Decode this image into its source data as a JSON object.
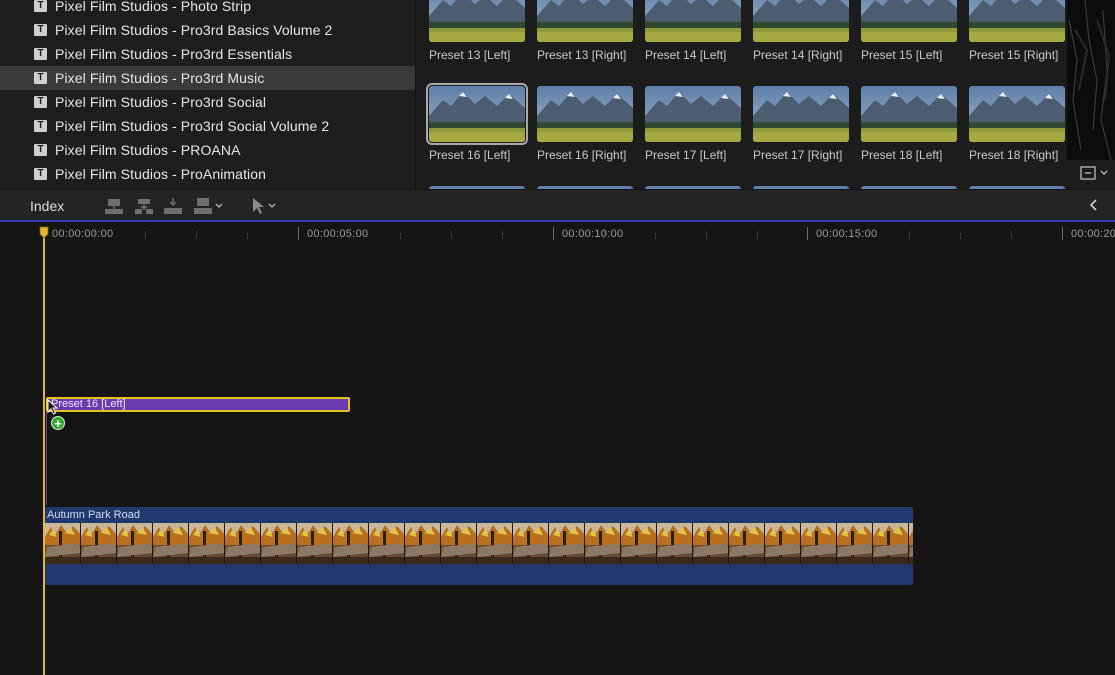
{
  "browser": {
    "libraries": [
      {
        "icon": "title-icon",
        "label": "Pixel Film Studios - Photo Strip",
        "selected": false
      },
      {
        "icon": "title-icon",
        "label": "Pixel Film Studios - Pro3rd Basics Volume 2",
        "selected": false
      },
      {
        "icon": "title-icon",
        "label": "Pixel Film Studios - Pro3rd Essentials",
        "selected": false
      },
      {
        "icon": "title-icon",
        "label": "Pixel Film Studios - Pro3rd Music",
        "selected": true
      },
      {
        "icon": "title-icon",
        "label": "Pixel Film Studios - Pro3rd Social",
        "selected": false
      },
      {
        "icon": "title-icon",
        "label": "Pixel Film Studios - Pro3rd Social Volume 2",
        "selected": false
      },
      {
        "icon": "title-icon",
        "label": "Pixel Film Studios - PROANA",
        "selected": false
      },
      {
        "icon": "title-icon",
        "label": "Pixel Film Studios - ProAnimation",
        "selected": false
      }
    ],
    "presets": [
      {
        "label": "Preset 13 [Left]",
        "selected": false
      },
      {
        "label": "Preset 13 [Right]",
        "selected": false
      },
      {
        "label": "Preset 14 [Left]",
        "selected": false
      },
      {
        "label": "Preset 14 [Right]",
        "selected": false
      },
      {
        "label": "Preset 15 [Left]",
        "selected": false
      },
      {
        "label": "Preset 15 [Right]",
        "selected": false
      },
      {
        "label": "Preset 16 [Left]",
        "selected": true
      },
      {
        "label": "Preset 16 [Right]",
        "selected": false
      },
      {
        "label": "Preset 17 [Left]",
        "selected": false
      },
      {
        "label": "Preset 17 [Right]",
        "selected": false
      },
      {
        "label": "Preset 18 [Left]",
        "selected": false
      },
      {
        "label": "Preset 18 [Right]",
        "selected": false
      }
    ]
  },
  "toolbar": {
    "index_label": "Index",
    "icons": [
      "connect-clip-icon",
      "insert-clip-icon",
      "append-clip-icon",
      "overwrite-clip-icon",
      "select-tool-icon",
      "collapse-icon"
    ]
  },
  "timeline": {
    "timecodes": [
      "00:00:00:00",
      "00:00:05:00",
      "00:00:10:00",
      "00:00:15:00",
      "00:00:20"
    ],
    "title_clip": {
      "label": "Preset 16 [Left]"
    },
    "video_clip": {
      "label": "Autumn Park Road"
    }
  },
  "colors": {
    "playhead": "#e0b830",
    "title_clip": "#6a3bb0",
    "video_clip": "#203a70",
    "selection_outline": "#e8c21a",
    "add_badge": "#2fa82f",
    "toolbar_accent": "#3b3bb5"
  }
}
